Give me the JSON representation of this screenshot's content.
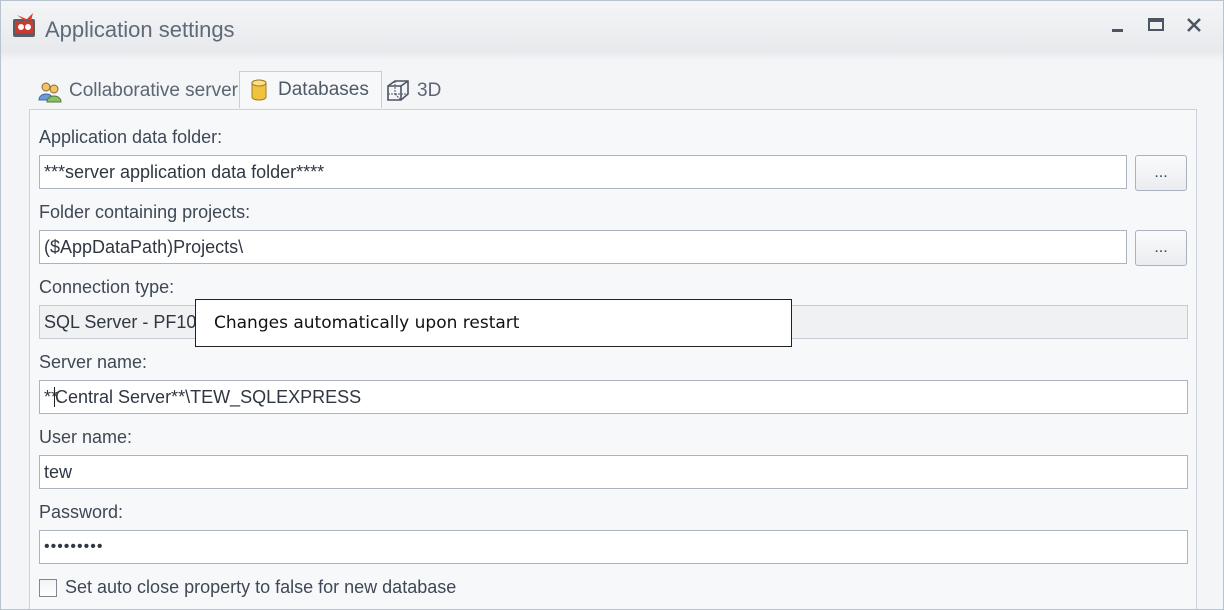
{
  "window": {
    "title": "Application settings",
    "controls": {
      "minimize_icon": "minimize-icon",
      "maximize_icon": "maximize-icon",
      "close_icon": "close-icon"
    }
  },
  "tabs": [
    {
      "label": "Collaborative server",
      "icon": "users-icon",
      "active": false
    },
    {
      "label": "Databases",
      "icon": "database-icon",
      "active": true
    },
    {
      "label": "3D",
      "icon": "cube-icon",
      "active": false
    }
  ],
  "form": {
    "app_data_folder": {
      "label": "Application data folder:",
      "value": "***server application data folder****",
      "browse_label": "..."
    },
    "projects_folder": {
      "label": "Folder containing projects:",
      "value": "($AppDataPath)Projects\\",
      "browse_label": "..."
    },
    "connection_type": {
      "label": "Connection type:",
      "value": "SQL Server - PF101"
    },
    "server_name": {
      "label": "Server name:",
      "value_prefix": "**",
      "value_suffix": "Central Server**\\TEW_SQLEXPRESS"
    },
    "user_name": {
      "label": "User name:",
      "value": "tew"
    },
    "password": {
      "label": "Password:",
      "value": "•••••••••"
    },
    "auto_close": {
      "label": "Set auto close property to false for new database",
      "checked": false
    }
  },
  "tooltip": {
    "text": "Changes automatically upon restart"
  },
  "colors": {
    "window_bg": "#f4f5f7",
    "border": "#aab3bf",
    "title_text": "#5f6a78"
  }
}
